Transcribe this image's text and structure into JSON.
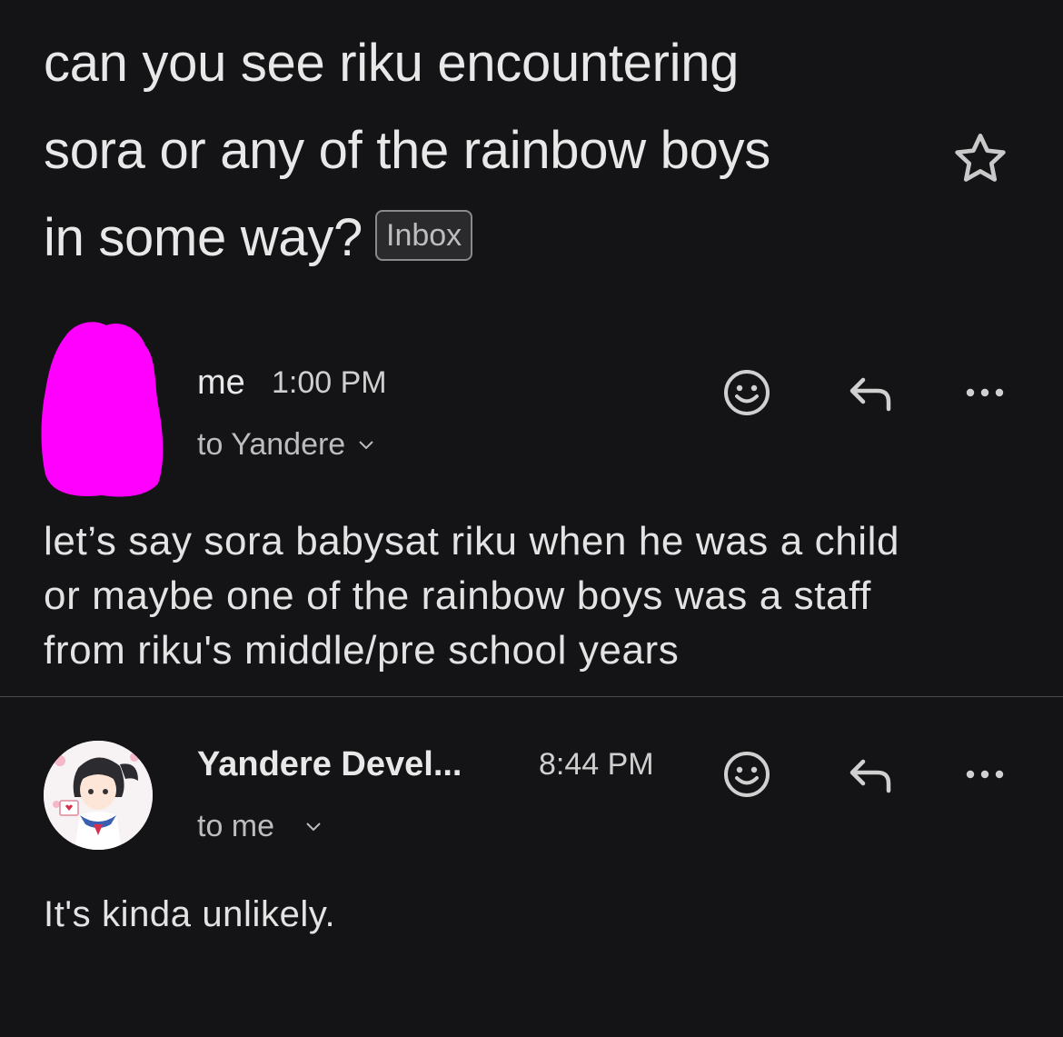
{
  "subject": {
    "line1": "can you see riku encountering",
    "line2": "sora or any of the rainbow boys",
    "line3": "in some way?",
    "badge": "Inbox"
  },
  "messages": [
    {
      "sender": "me",
      "time": "1:00 PM",
      "recipient": "to Yandere",
      "body": [
        "let’s say sora babysat riku when he was a child",
        "or maybe one of the rainbow boys was a staff",
        "from riku's middle/pre school years"
      ]
    },
    {
      "sender": "Yandere Devel...",
      "time": "8:44 PM",
      "recipient": "to me",
      "body": [
        "It's kinda unlikely."
      ]
    }
  ],
  "colors": {
    "background": "#141416",
    "text": "#e3e3e3",
    "avatar_redaction": "#ff00ff"
  },
  "icons": {
    "star": "star-icon",
    "emoji": "emoji-react-icon",
    "reply": "reply-icon",
    "more": "more-options-icon",
    "chevron": "chevron-down-icon"
  }
}
